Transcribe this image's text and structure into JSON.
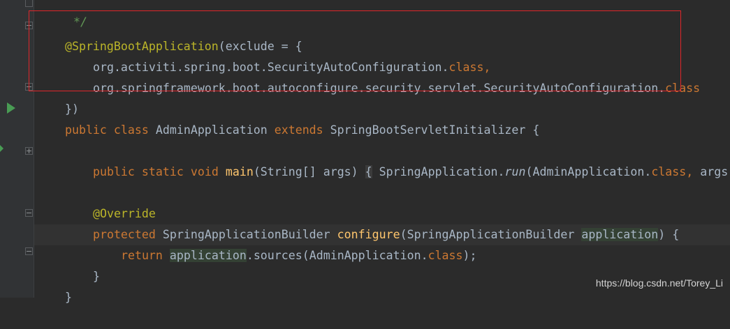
{
  "colors": {
    "background": "#2b2b2b",
    "keyword": "#cc7832",
    "annotation": "#bbb529",
    "method": "#ffc66d",
    "text": "#a9b7c6",
    "comment": "#629755",
    "highlight_box": "#e0262a"
  },
  "code": {
    "l0": "*/",
    "l1_annotation": "@SpringBootApplication",
    "l1_rest": "(exclude = {",
    "l2_pkg": "org.activiti.spring.boot.SecurityAutoConfiguration.",
    "l2_kw": "class,",
    "l3_pkg": "org.springframework.boot.autoconfigure.security.servlet.SecurityAutoConfiguration.",
    "l3_kw": "class",
    "l4": "})",
    "l5_public": "public",
    "l5_class": "class",
    "l5_name": "AdminApplication",
    "l5_extends": "extends",
    "l5_parent": "SpringBootServletInitializer",
    "l5_brace": "{",
    "l7_public": "public",
    "l7_static": "static",
    "l7_void": "void",
    "l7_main": "main",
    "l7_params": "(String[] args)",
    "l7_open": "{",
    "l7_app": "SpringApplication.",
    "l7_run": "run",
    "l7_arg1": "(AdminApplication.",
    "l7_class": "class,",
    "l7_args": "args)",
    "l7_semi": ";",
    "l7_close": "}",
    "l9": "@Override",
    "l10_protected": "protected",
    "l10_type": "SpringApplicationBuilder",
    "l10_configure": "configure",
    "l10_paren": "(SpringApplicationBuilder",
    "l10_param": "application",
    "l10_end": ") {",
    "l11_return": "return",
    "l11_param": "application",
    "l11_sources": ".sources(AdminApplication.",
    "l11_class": "class",
    "l11_end": ");",
    "l12": "}",
    "l13": "}"
  },
  "watermark": "https://blog.csdn.net/Torey_Li"
}
